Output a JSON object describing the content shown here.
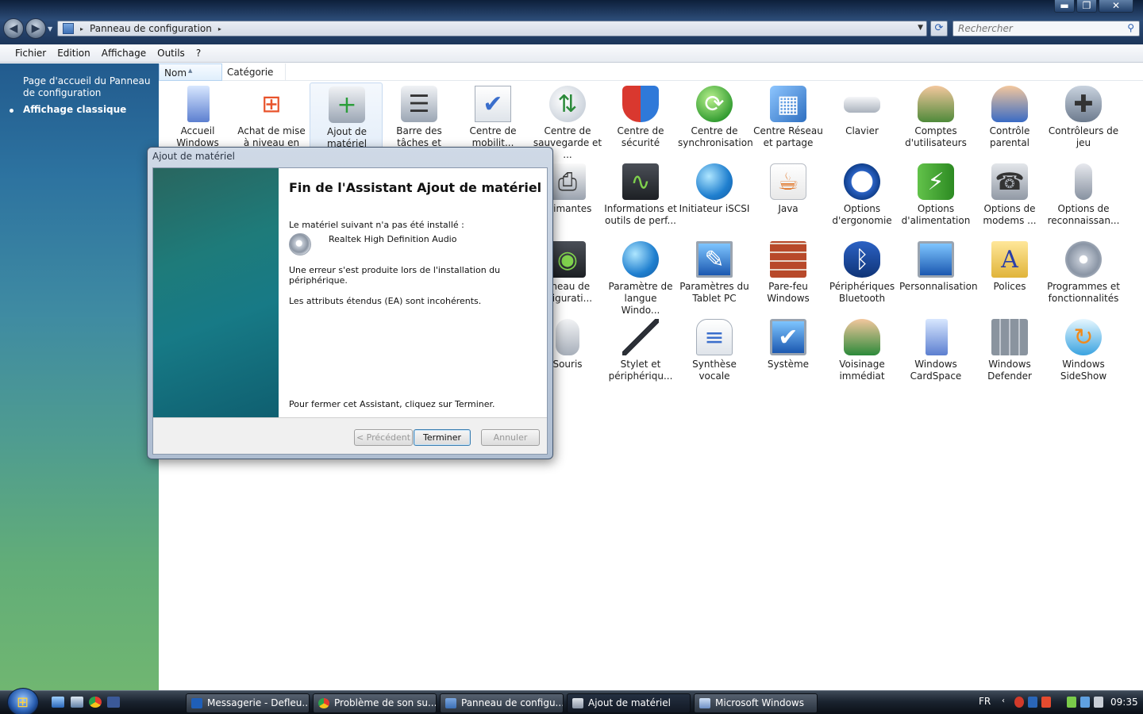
{
  "window": {
    "controls": {
      "minimize": "▬",
      "maximize": "❐",
      "close": "✕"
    }
  },
  "address": {
    "path": "Panneau de configuration",
    "separator": "▸",
    "search_placeholder": "Rechercher"
  },
  "menu": [
    "Fichier",
    "Edition",
    "Affichage",
    "Outils",
    "?"
  ],
  "left_pane": {
    "link": "Page d'accueil du Panneau de configuration",
    "active": "Affichage classique"
  },
  "columns": {
    "name": "Nom",
    "category": "Catégorie"
  },
  "items": {
    "r0": [
      "Accueil Windows",
      "Achat de mise à niveau en ligne",
      "Ajout de matériel",
      "Barre des tâches et menu Dém...",
      "Centre de mobilit...",
      "Centre de sauvegarde et ...",
      "Centre de sécurité",
      "Centre de synchronisation",
      "Centre Réseau et partage",
      "Clavier",
      "Comptes d'utilisateurs",
      "Contrôle parental",
      "Contrôleurs de jeu"
    ],
    "r1": [
      "primantes",
      "Informations et outils de perf...",
      "Initiateur iSCSI",
      "Java",
      "Options d'ergonomie",
      "Options d'alimentation",
      "Options de modems ...",
      "Options de reconnaissan..."
    ],
    "r2": [
      "nneau de nfigurati...",
      "Paramètre de langue Windo...",
      "Paramètres du Tablet PC",
      "Pare-feu Windows",
      "Périphériques Bluetooth",
      "Personnalisation",
      "Polices",
      "Programmes et fonctionnalités"
    ],
    "r3": [
      "Souris",
      "Stylet et périphériqu...",
      "Synthèse vocale",
      "Système",
      "Voisinage immédiat",
      "Windows CardSpace",
      "Windows Defender",
      "Windows SideShow"
    ]
  },
  "dialog": {
    "title": "Ajout de matériel",
    "heading": "Fin de l'Assistant Ajout de matériel",
    "line1": "Le matériel suivant n'a pas été installé :",
    "device": "Realtek High Definition Audio",
    "error": "Une erreur s'est produite lors de l'installation du périphérique.",
    "detail": "Les attributs étendus (EA) sont incohérents.",
    "close_hint": "Pour fermer cet Assistant, cliquez sur Terminer.",
    "btn_prev": "< Précédent",
    "btn_finish": "Terminer",
    "btn_cancel": "Annuler"
  },
  "taskbar": {
    "buttons": [
      "Messagerie - Defleu...",
      "Problème de son su...",
      "Panneau de configu...",
      "Ajout de matériel",
      "Microsoft Windows"
    ],
    "lang": "FR",
    "time": "09:35"
  },
  "colors": {
    "accent": "#2a5db0",
    "dialog_side": "#1e7b7a",
    "left_pane_top": "#225b8e",
    "left_pane_bottom": "#70b671"
  }
}
